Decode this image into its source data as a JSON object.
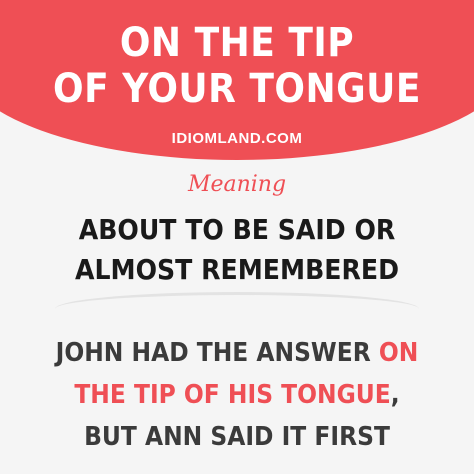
{
  "header": {
    "title_line1": "On the tip",
    "title_line2": "of your tongue",
    "site": "idiomland.com"
  },
  "meaning": {
    "label": "Meaning",
    "line1": "About to be said or",
    "line2": "almost remembered"
  },
  "example": {
    "line1_a": "John had the answer ",
    "line1_b": "on",
    "line2_a": "the tip of his tongue",
    "line2_b": ",",
    "line3": "but Ann said it first"
  },
  "colors": {
    "accent": "#ef4f55",
    "background": "#f5f5f5",
    "text_dark": "#1a1a1a",
    "text_example": "#3b3b3b"
  }
}
